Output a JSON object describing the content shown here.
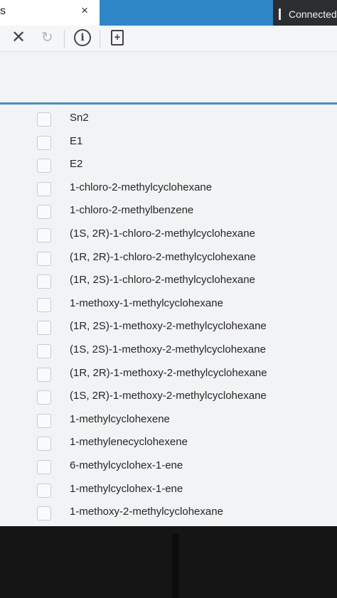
{
  "tab": {
    "title": "s",
    "close_glyph": "×"
  },
  "status": {
    "connected_label": "Connected"
  },
  "toolbar": {
    "close_glyph": "✕",
    "refresh_glyph": "↻",
    "info_glyph": "i",
    "add_page_glyph": "+",
    "icons": [
      "close-icon",
      "refresh-icon",
      "info-icon",
      "add-page-icon"
    ]
  },
  "options": [
    "Sn2",
    "E1",
    "E2",
    "1-chloro-2-methylcyclohexane",
    "1-chloro-2-methylbenzene",
    "(1S, 2R)-1-chloro-2-methylcyclohexane",
    "(1R, 2R)-1-chloro-2-methylcyclohexane",
    "(1R, 2S)-1-chloro-2-methylcyclohexane",
    "1-methoxy-1-methylcyclohexane",
    "(1R, 2S)-1-methoxy-2-methylcyclohexane",
    "(1S, 2S)-1-methoxy-2-methylcyclohexane",
    "(1R, 2R)-1-methoxy-2-methylcyclohexane",
    "(1S, 2R)-1-methoxy-2-methylcyclohexane",
    "1-methylcyclohexene",
    "1-methylenecyclohexene",
    "6-methylcyclohex-1-ene",
    "1-methylcyclohex-1-ene",
    "1-methoxy-2-methylcyclohexane"
  ],
  "colors": {
    "accent": "#2f86c7",
    "divider": "#4b90c9",
    "status_bg": "#2b2d30"
  }
}
